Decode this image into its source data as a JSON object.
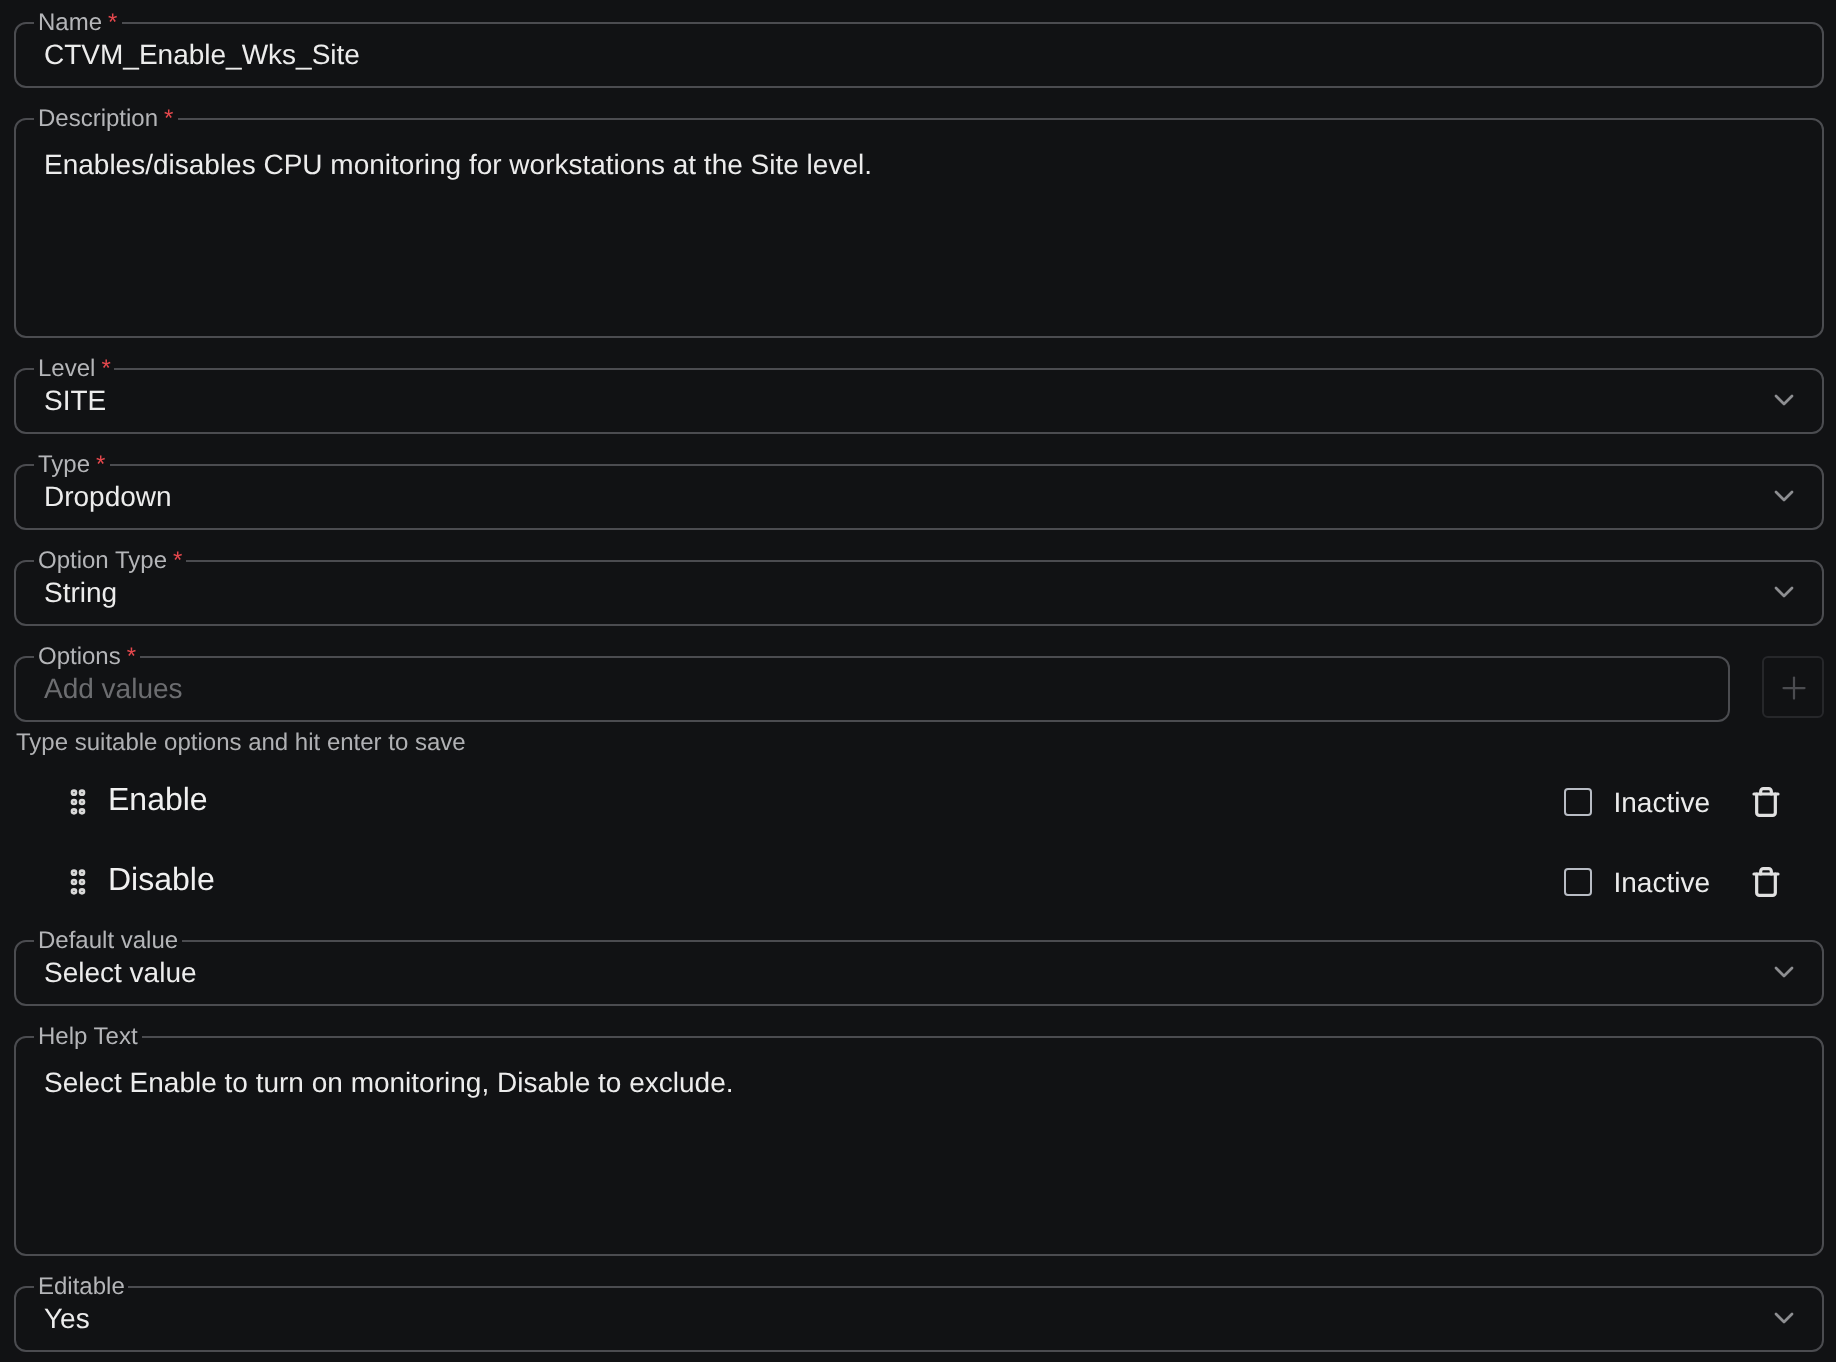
{
  "fields": [
    {
      "kind": "text",
      "label": "Name",
      "required_mark": "*",
      "value": "CTVM_Enable_Wks_Site"
    },
    {
      "kind": "textarea",
      "label": "Description",
      "required_mark": "*",
      "value": "Enables/disables CPU monitoring for workstations at the Site level."
    },
    {
      "kind": "select",
      "label": "Level",
      "required_mark": "*",
      "value": "SITE"
    },
    {
      "kind": "select",
      "label": "Type",
      "required_mark": "*",
      "value": "Dropdown"
    },
    {
      "kind": "select",
      "label": "Option Type",
      "required_mark": "*",
      "value": "String"
    },
    {
      "kind": "tags",
      "label": "Options",
      "required_mark": "*",
      "placeholder": "Add values",
      "add_disabled": true,
      "hint": "Type suitable options and hit enter to save",
      "items": [
        {
          "label": "Enable",
          "checkbox_label": "Inactive",
          "checked": false
        },
        {
          "label": "Disable",
          "checkbox_label": "Inactive",
          "checked": false
        }
      ]
    },
    {
      "kind": "select",
      "label": "Default value",
      "value": "Select value"
    },
    {
      "kind": "textarea",
      "label": "Help Text",
      "value": "Select Enable to turn on monitoring, Disable to exclude."
    },
    {
      "kind": "select",
      "label": "Editable",
      "value": "Yes"
    }
  ]
}
